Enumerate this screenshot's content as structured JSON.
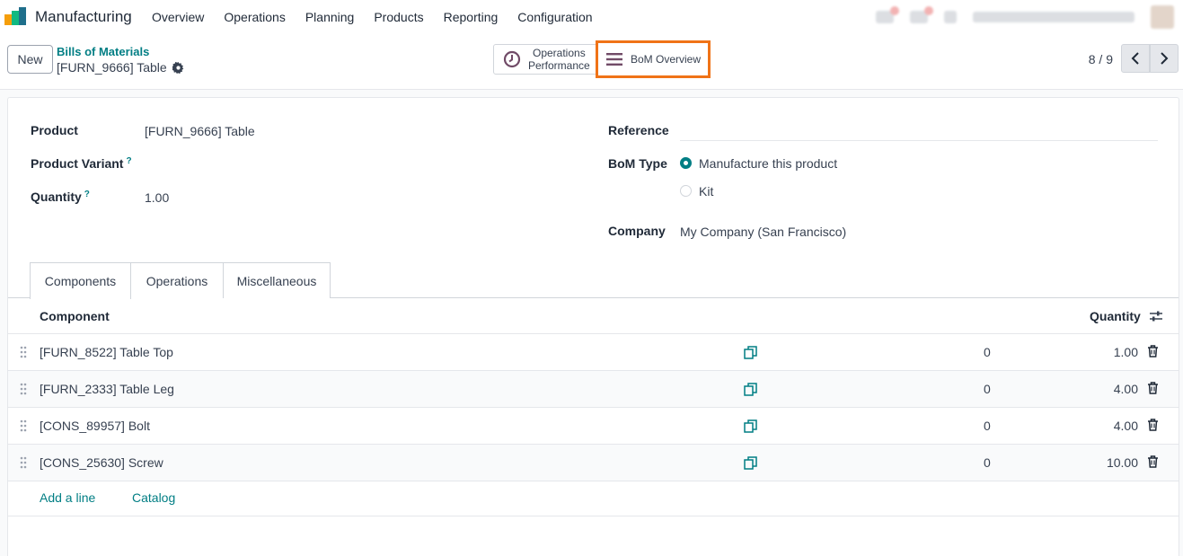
{
  "navbar": {
    "app_name": "Manufacturing",
    "menu": [
      "Overview",
      "Operations",
      "Planning",
      "Products",
      "Reporting",
      "Configuration"
    ]
  },
  "control": {
    "new_label": "New",
    "breadcrumb_parent": "Bills of Materials",
    "breadcrumb_current": "[FURN_9666] Table",
    "ops_perf_line1": "Operations",
    "ops_perf_line2": "Performance",
    "bom_overview": "BoM Overview",
    "pager": "8 / 9"
  },
  "form": {
    "product_label": "Product",
    "product_value": "[FURN_9666] Table",
    "variant_label": "Product Variant",
    "quantity_label": "Quantity",
    "quantity_value": "1.00",
    "help_mark": "?",
    "reference_label": "Reference",
    "bom_type_label": "BoM Type",
    "bom_type_option1": "Manufacture this product",
    "bom_type_option2": "Kit",
    "bom_type_selected": "Manufacture this product",
    "company_label": "Company",
    "company_value": "My Company (San Francisco)"
  },
  "tabs": [
    "Components",
    "Operations",
    "Miscellaneous"
  ],
  "active_tab": "Components",
  "table": {
    "col_component": "Component",
    "col_quantity": "Quantity",
    "rows": [
      {
        "component": "[FURN_8522] Table Top",
        "mid": "0",
        "quantity": "1.00"
      },
      {
        "component": "[FURN_2333] Table Leg",
        "mid": "0",
        "quantity": "4.00"
      },
      {
        "component": "[CONS_89957] Bolt",
        "mid": "0",
        "quantity": "4.00"
      },
      {
        "component": "[CONS_25630] Screw",
        "mid": "0",
        "quantity": "10.00"
      }
    ],
    "add_line": "Add a line",
    "catalog": "Catalog"
  },
  "colors": {
    "accent": "#017e84",
    "highlight": "#f07317",
    "brand": "#714b67"
  }
}
